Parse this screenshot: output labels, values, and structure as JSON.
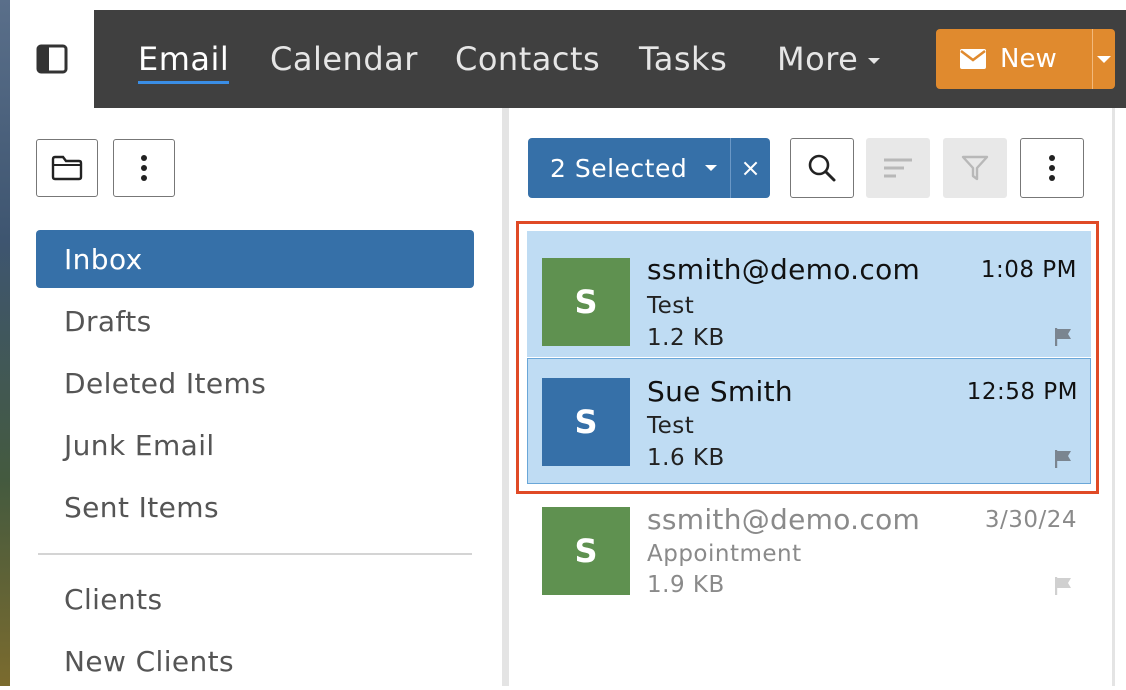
{
  "nav": {
    "items": [
      {
        "label": "Email",
        "active": true
      },
      {
        "label": "Calendar"
      },
      {
        "label": "Contacts"
      },
      {
        "label": "Tasks"
      },
      {
        "label": "More"
      }
    ],
    "new_button_label": "New",
    "colors": {
      "bar": "#404040",
      "new_button": "#e08a2e",
      "active_underline": "#3a8ee6"
    }
  },
  "sidebar": {
    "folders": [
      {
        "label": "Inbox",
        "active": true
      },
      {
        "label": "Drafts"
      },
      {
        "label": "Deleted Items"
      },
      {
        "label": "Junk Email"
      },
      {
        "label": "Sent Items"
      }
    ],
    "custom_folders": [
      {
        "label": "Clients"
      },
      {
        "label": "New Clients"
      }
    ],
    "accent": "#3670a8"
  },
  "list_toolbar": {
    "selected_label": "2 Selected",
    "clear_label": "×"
  },
  "emails": [
    {
      "avatar_letter": "S",
      "avatar_color": "#5f9150",
      "sender": "ssmith@demo.com",
      "subject": "Test",
      "size": "1.2 KB",
      "time": "1:08 PM",
      "selected": true
    },
    {
      "avatar_letter": "S",
      "avatar_color": "#3670a8",
      "sender": "Sue Smith",
      "subject": "Test",
      "size": "1.6 KB",
      "time": "12:58 PM",
      "selected": true
    },
    {
      "avatar_letter": "S",
      "avatar_color": "#5f9150",
      "sender": "ssmith@demo.com",
      "subject": "Appointment",
      "size": "1.9 KB",
      "time": "3/30/24",
      "selected": false
    }
  ],
  "highlight_color": "#e04a26"
}
